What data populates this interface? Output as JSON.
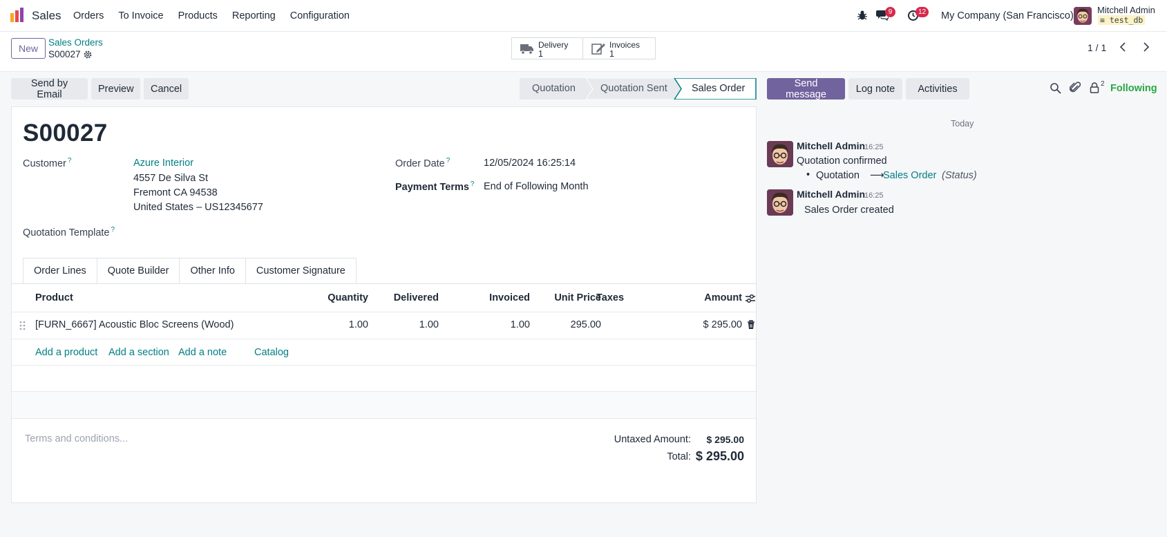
{
  "app": {
    "name": "Sales"
  },
  "menu": [
    "Orders",
    "To Invoice",
    "Products",
    "Reporting",
    "Configuration"
  ],
  "systray": {
    "messages_count": "9",
    "activities_count": "12",
    "company": "My Company (San Francisco)",
    "user": "Mitchell Admin",
    "db": "test_db"
  },
  "control": {
    "new_label": "New",
    "breadcrumb_parent": "Sales Orders",
    "breadcrumb_current": "S00027",
    "smart_buttons": [
      {
        "label": "Delivery",
        "value": "1",
        "icon": "truck-icon"
      },
      {
        "label": "Invoices",
        "value": "1",
        "icon": "invoice-icon"
      }
    ],
    "pager": "1 / 1"
  },
  "actions": [
    "Send by Email",
    "Preview",
    "Cancel"
  ],
  "statusbar": {
    "stages": [
      "Quotation",
      "Quotation Sent",
      "Sales Order"
    ],
    "active": "Sales Order"
  },
  "form": {
    "name": "S00027",
    "customer_label": "Customer",
    "customer_name": "Azure Interior",
    "address": [
      "4557 De Silva St",
      "Fremont CA 94538",
      "United States – US12345677"
    ],
    "order_date_label": "Order Date",
    "order_date": "12/05/2024 16:25:14",
    "payment_terms_label": "Payment Terms",
    "payment_terms": "End of Following Month",
    "quotation_template_label": "Quotation Template",
    "help_mark": "?"
  },
  "tabs": [
    "Order Lines",
    "Quote Builder",
    "Other Info",
    "Customer Signature"
  ],
  "lines": {
    "headers": {
      "product": "Product",
      "quantity": "Quantity",
      "delivered": "Delivered",
      "invoiced": "Invoiced",
      "unit_price": "Unit Price",
      "taxes": "Taxes",
      "amount": "Amount"
    },
    "rows": [
      {
        "product": "[FURN_6667] Acoustic Bloc Screens (Wood)",
        "quantity": "1.00",
        "delivered": "1.00",
        "invoiced": "1.00",
        "unit_price": "295.00",
        "taxes": "",
        "amount": "$ 295.00"
      }
    ],
    "add_links": [
      "Add a product",
      "Add a section",
      "Add a note",
      "Catalog"
    ]
  },
  "totals": {
    "terms_placeholder": "Terms and conditions...",
    "untaxed_label": "Untaxed Amount:",
    "untaxed_value": "$ 295.00",
    "total_label": "Total:",
    "total_value": "$ 295.00"
  },
  "chatter": {
    "send_message": "Send message",
    "log_note": "Log note",
    "activities": "Activities",
    "followers_count": "2",
    "following": "Following",
    "today": "Today",
    "messages": [
      {
        "author": "Mitchell Admin",
        "time": "16:25",
        "body": "Quotation confirmed",
        "tracking_old": "Quotation",
        "tracking_arrow": "⟶",
        "tracking_new": "Sales Order",
        "tracking_field": "(Status)"
      },
      {
        "author": "Mitchell Admin",
        "time": "16:25",
        "body": "Sales Order created"
      }
    ]
  },
  "colors": {
    "primary": "#71639e",
    "link": "#017e84",
    "following": "#28a745",
    "badge": "#d6294d"
  }
}
